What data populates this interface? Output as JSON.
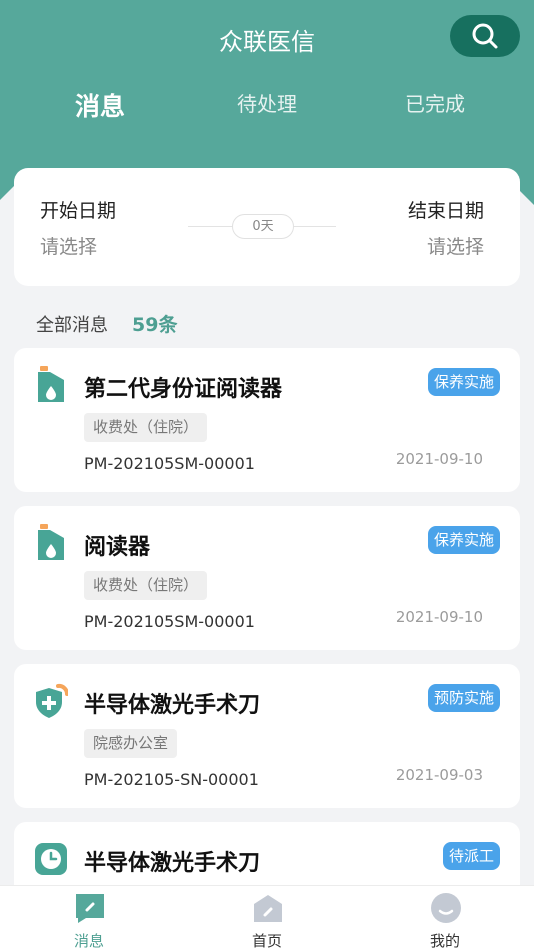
{
  "header": {
    "title": "众联医信",
    "tabs": [
      {
        "label": "消息",
        "active": true
      },
      {
        "label": "待处理",
        "active": false
      },
      {
        "label": "已完成",
        "active": false
      }
    ]
  },
  "colors": {
    "primary": "#56a89b",
    "search_button": "#17705f",
    "tag_blue": "#4aa3ea",
    "icon_teal": "#48a596",
    "icon_orange": "#f5a55a"
  },
  "date_filter": {
    "start_label": "开始日期",
    "start_placeholder": "请选择",
    "end_label": "结束日期",
    "end_placeholder": "请选择",
    "days": "0天"
  },
  "summary": {
    "label": "全部消息",
    "count": "59条"
  },
  "messages": [
    {
      "icon": "oil-can-icon",
      "name": "第二代身份证阅读器",
      "tag": "保养实施",
      "dept": "收费处（住院）",
      "code": "PM-202105SM-00001",
      "date": "2021-09-10"
    },
    {
      "icon": "oil-can-icon",
      "name": "阅读器",
      "tag": "保养实施",
      "dept": "收费处（住院）",
      "code": "PM-202105SM-00001",
      "date": "2021-09-10"
    },
    {
      "icon": "shield-plus-icon",
      "name": "半导体激光手术刀",
      "tag": "预防实施",
      "dept": "院感办公室",
      "code": "PM-202105-SN-00001",
      "date": "2021-09-03"
    },
    {
      "icon": "clock-icon",
      "name": "半导体激光手术刀",
      "tag": "待派工",
      "dept": "",
      "code": "",
      "date": ""
    }
  ],
  "bottom_nav": [
    {
      "label": "消息",
      "icon": "message-icon",
      "active": true
    },
    {
      "label": "首页",
      "icon": "home-icon",
      "active": false
    },
    {
      "label": "我的",
      "icon": "profile-icon",
      "active": false
    }
  ]
}
